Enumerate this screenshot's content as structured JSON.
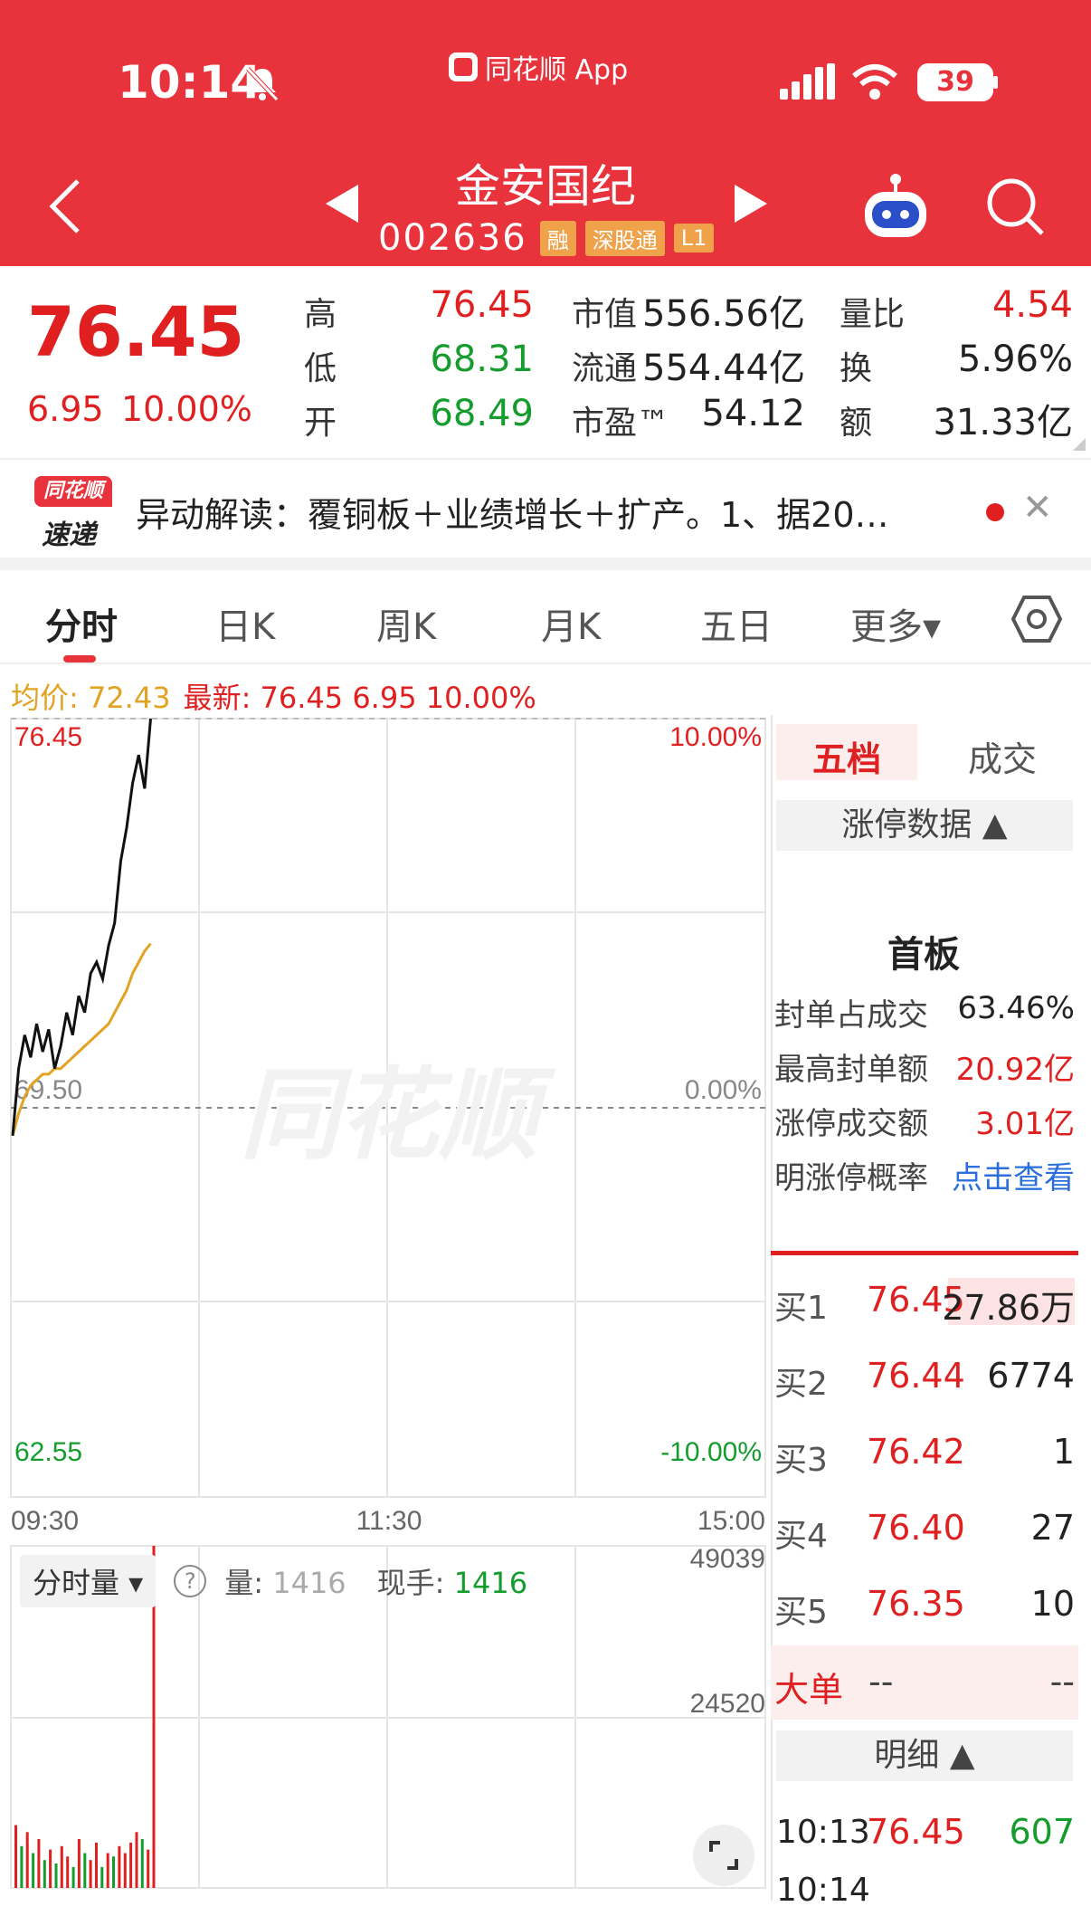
{
  "status_bar": {
    "time": "10:14",
    "source_app": "同花顺 App",
    "battery": "39"
  },
  "header": {
    "title": "金安国纪",
    "code": "002636",
    "tags": [
      "融",
      "深股通",
      "L1"
    ]
  },
  "quote": {
    "price": "76.45",
    "change": "6.95",
    "change_pct": "10.00%",
    "high_label": "高",
    "high": "76.45",
    "low_label": "低",
    "low": "68.31",
    "open_label": "开",
    "open": "68.49",
    "mktcap_label": "市值",
    "mktcap": "556.56亿",
    "float_label": "流通",
    "float": "554.44亿",
    "pe_label": "市盈™",
    "pe": "54.12",
    "volratio_label": "量比",
    "volratio": "4.54",
    "turnover_label": "换",
    "turnover": "5.96%",
    "amount_label": "额",
    "amount": "31.33亿"
  },
  "news": {
    "logo_top": "同花顺",
    "logo_bottom": "速递",
    "text": "异动解读：覆铜板＋业绩增长＋扩产。1、据20…"
  },
  "tabs": [
    "分时",
    "日K",
    "周K",
    "月K",
    "五日",
    "更多▾"
  ],
  "info_line": {
    "avg": "均价: 72.43",
    "latest": "最新: 76.45  6.95  10.00%"
  },
  "chart_axes": {
    "y_top": "76.45",
    "y_mid": "69.50",
    "y_bottom": "62.55",
    "pct_top": "10.00%",
    "pct_mid": "0.00%",
    "pct_bottom": "-10.00%",
    "x_labels": [
      "09:30",
      "11:30",
      "15:00"
    ],
    "watermark": "同花顺"
  },
  "chart_data": {
    "type": "line",
    "x_range": [
      "09:30",
      "15:00"
    ],
    "ylim": [
      62.55,
      76.45
    ],
    "series": [
      {
        "name": "最新",
        "color": "#111111",
        "values": [
          69.0,
          70.2,
          70.8,
          70.4,
          71.0,
          70.5,
          70.9,
          70.2,
          70.6,
          71.2,
          70.8,
          71.5,
          71.2,
          71.9,
          72.1,
          71.8,
          72.4,
          72.8,
          73.9,
          74.5,
          75.3,
          75.8,
          75.2,
          76.45
        ]
      },
      {
        "name": "均价",
        "color": "#e2a222",
        "values": [
          69.0,
          69.4,
          69.7,
          69.9,
          70.0,
          70.1,
          70.1,
          70.2,
          70.2,
          70.3,
          70.4,
          70.5,
          70.6,
          70.7,
          70.8,
          70.9,
          71.0,
          71.2,
          71.4,
          71.6,
          71.9,
          72.1,
          72.3,
          72.43
        ]
      }
    ],
    "volume": {
      "ylim": [
        0,
        49039
      ],
      "ticks": [
        "49039",
        "24520"
      ],
      "bars": [
        9000,
        6000,
        8000,
        5000,
        7000,
        4000,
        5500,
        3500,
        6000,
        4500,
        3000,
        7000,
        5000,
        4000,
        6500,
        3000,
        5000,
        4500,
        6000,
        5000,
        6500,
        8000,
        7000,
        5500,
        49039
      ],
      "colors": [
        "r",
        "g",
        "r",
        "g",
        "r",
        "g",
        "r",
        "g",
        "r",
        "r",
        "g",
        "r",
        "g",
        "r",
        "r",
        "g",
        "r",
        "g",
        "r",
        "r",
        "r",
        "r",
        "g",
        "r",
        "r"
      ]
    }
  },
  "volume_header": {
    "dropdown": "分时量 ▾",
    "q_mark": "?",
    "vol_label": "量:",
    "vol_value": "1416",
    "hand_label": "现手:",
    "hand_value": "1416"
  },
  "right_panel": {
    "tab_wudang": "五档",
    "tab_chengjiao": "成交",
    "limit_btn": "涨停数据 ▲",
    "board": "首板",
    "rows": [
      {
        "label": "封单占成交",
        "value": "63.46%"
      },
      {
        "label": "最高封单额",
        "value": "20.92亿"
      },
      {
        "label": "涨停成交额",
        "value": "3.01亿"
      },
      {
        "label": "明涨停概率",
        "value": "点击查看"
      }
    ],
    "orderbook": [
      {
        "label": "买1",
        "price": "76.45",
        "vol": "27.86万"
      },
      {
        "label": "买2",
        "price": "76.44",
        "vol": "6774"
      },
      {
        "label": "买3",
        "price": "76.42",
        "vol": "1"
      },
      {
        "label": "买4",
        "price": "76.40",
        "vol": "27"
      },
      {
        "label": "买5",
        "price": "76.35",
        "vol": "10"
      }
    ],
    "big_order": {
      "label": "大单",
      "v1": "--",
      "v2": "--"
    },
    "detail_btn": "明细 ▲",
    "trades": [
      {
        "time": "10:13",
        "price": "76.45",
        "vol": "607"
      },
      {
        "time": "10:14",
        "price": "",
        "vol": ""
      }
    ]
  },
  "colors": {
    "brand_red": "#e8333c",
    "up": "#e02020",
    "down": "#149c2c",
    "avg": "#e2a222"
  }
}
